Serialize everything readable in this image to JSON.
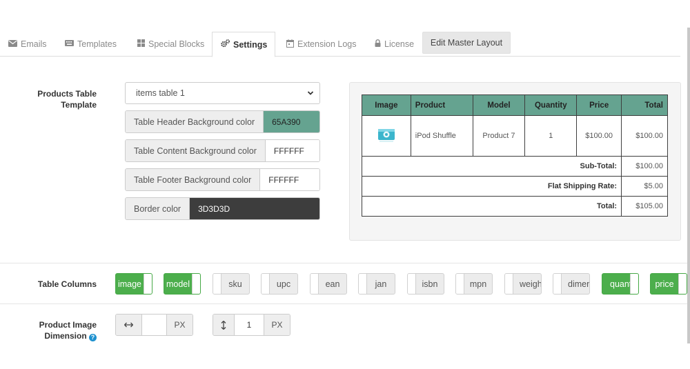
{
  "tabs": [
    {
      "label": "Emails",
      "icon": "envelope-icon"
    },
    {
      "label": "Templates",
      "icon": "keyboard-icon"
    },
    {
      "label": "Special Blocks",
      "icon": "grid-icon"
    },
    {
      "label": "Settings",
      "icon": "gears-icon",
      "active": true
    },
    {
      "label": "Extension Logs",
      "icon": "calendar-icon"
    },
    {
      "label": "License",
      "icon": "lock-icon"
    }
  ],
  "master_button": "Edit Master Layout",
  "form": {
    "template_label": "Products Table Template",
    "template_label_l1": "Products Table",
    "template_label_l2": "Template",
    "template_value": "items table 1",
    "header_bg_label": "Table Header Background color",
    "header_bg_value": "65A390",
    "content_bg_label": "Table Content Background color",
    "content_bg_value": "FFFFFF",
    "footer_bg_label": "Table Footer Background color",
    "footer_bg_value": "FFFFFF",
    "border_label": "Border color",
    "border_value": "3D3D3D"
  },
  "colors": {
    "header_bg": "#65A390",
    "border": "#3D3D3D",
    "toggle_on": "#4cae4c",
    "help": "#1e91cf"
  },
  "preview": {
    "headers": [
      "Image",
      "Product",
      "Model",
      "Quantity",
      "Price",
      "Total"
    ],
    "item": {
      "product": "iPod Shuffle",
      "model": "Product 7",
      "quantity": "1",
      "price": "$100.00",
      "total": "$100.00"
    },
    "totals": [
      {
        "label": "Sub-Total:",
        "value": "$100.00"
      },
      {
        "label": "Flat Shipping Rate:",
        "value": "$5.00"
      },
      {
        "label": "Total:",
        "value": "$105.00"
      }
    ]
  },
  "columns": {
    "label": "Table Columns",
    "items": [
      {
        "label": "image",
        "on": true
      },
      {
        "label": "model",
        "on": true
      },
      {
        "label": "sku",
        "on": false
      },
      {
        "label": "upc",
        "on": false
      },
      {
        "label": "ean",
        "on": false
      },
      {
        "label": "jan",
        "on": false
      },
      {
        "label": "isbn",
        "on": false
      },
      {
        "label": "mpn",
        "on": false
      },
      {
        "label": "weight",
        "on": false
      },
      {
        "label": "dimensions",
        "on": false
      },
      {
        "label": "quantity",
        "on": true
      },
      {
        "label": "price",
        "on": true
      }
    ]
  },
  "dimension": {
    "label_l1": "Product Image",
    "label_l2": "Dimension",
    "width_icon": "horizontal-arrows-icon",
    "width_value": "",
    "width_unit": "PX",
    "height_icon": "vertical-arrows-icon",
    "height_value": "1",
    "height_unit": "PX"
  }
}
